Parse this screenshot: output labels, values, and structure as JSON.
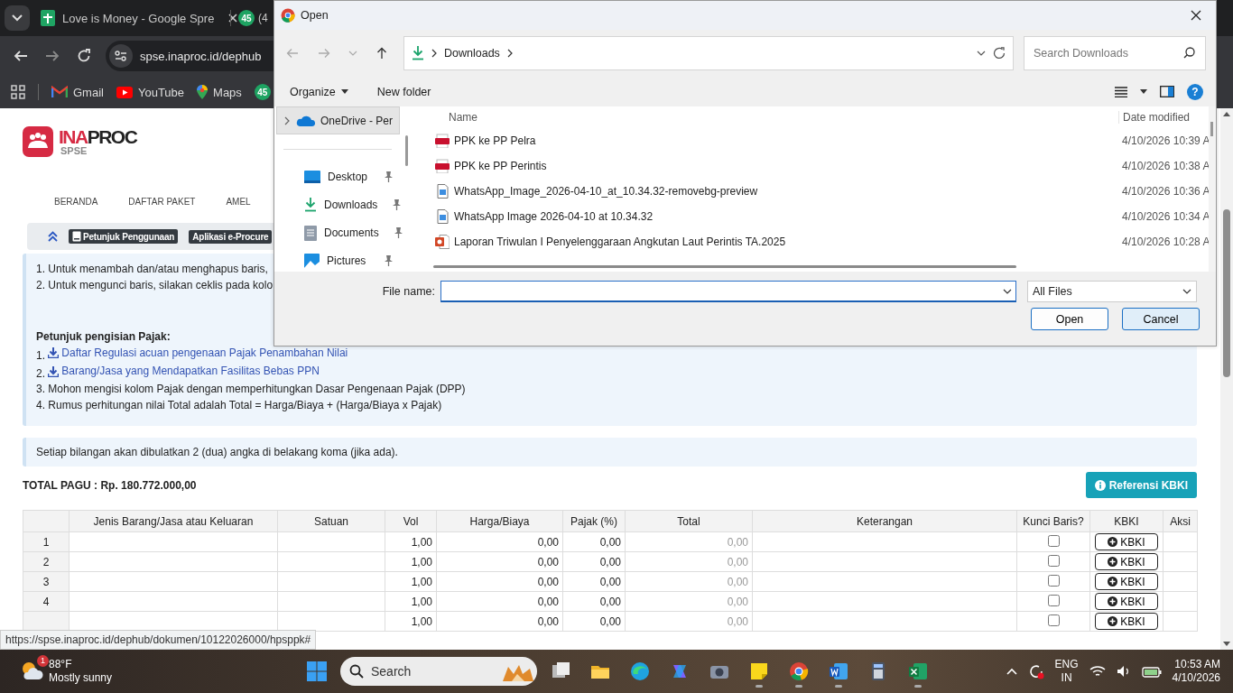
{
  "browser": {
    "tabs": [
      {
        "title": "Love is Money - Google Spre"
      },
      {
        "badge": "45",
        "title": "(4"
      }
    ],
    "address": "spse.inaproc.id/dephub",
    "bookmarks": [
      {
        "kind": "gmail",
        "label": "Gmail"
      },
      {
        "kind": "youtube",
        "label": "YouTube"
      },
      {
        "kind": "maps",
        "label": "Maps"
      },
      {
        "kind": "badge",
        "label": "45"
      }
    ]
  },
  "page": {
    "logo": {
      "prefix": "INA",
      "suffix": "PROC",
      "sub": "SPSE"
    },
    "nav": [
      "BERANDA",
      "DAFTAR PAKET",
      "AMEL"
    ],
    "help_bar": [
      "Petunjuk Penggunaan",
      "Aplikasi e-Procure"
    ],
    "instructions": [
      "1. Untuk menambah dan/atau menghapus baris,",
      "2. Untuk mengunci baris, silakan ceklis pada kolo"
    ],
    "tax_title": "Petunjuk pengisian Pajak:",
    "tax_items": [
      {
        "kind": "link",
        "number": "1.",
        "text": "Daftar Regulasi acuan pengenaan Pajak Penambahan Nilai"
      },
      {
        "kind": "link",
        "number": "2.",
        "text": "Barang/Jasa yang Mendapatkan Fasilitas Bebas PPN"
      },
      {
        "kind": "text",
        "text": "3. Mohon mengisi kolom Pajak dengan memperhitungkan Dasar Pengenaan Pajak (DPP)"
      },
      {
        "kind": "text",
        "text": "4. Rumus perhitungan nilai Total adalah Total = Harga/Biaya + (Harga/Biaya x Pajak)"
      }
    ],
    "note": "Setiap bilangan akan dibulatkan 2 (dua) angka di belakang koma (jika ada).",
    "total_pagu": "TOTAL PAGU : Rp. 180.772.000,00",
    "kbki_reference_button": "Referensi KBKI",
    "table": {
      "columns": [
        "",
        "Jenis Barang/Jasa atau Keluaran",
        "Satuan",
        "Vol",
        "Harga/Biaya",
        "Pajak (%)",
        "Total",
        "Keterangan",
        "Kunci Baris?",
        "KBKI",
        "Aksi"
      ],
      "rows": [
        {
          "no": "1",
          "vol": "1,00",
          "price": "0,00",
          "tax": "0,00",
          "total": "0,00",
          "locked": false,
          "kbki": "KBKI"
        },
        {
          "no": "2",
          "vol": "1,00",
          "price": "0,00",
          "tax": "0,00",
          "total": "0,00",
          "locked": false,
          "kbki": "KBKI"
        },
        {
          "no": "3",
          "vol": "1,00",
          "price": "0,00",
          "tax": "0,00",
          "total": "0,00",
          "locked": false,
          "kbki": "KBKI"
        },
        {
          "no": "4",
          "vol": "1,00",
          "price": "0,00",
          "tax": "0,00",
          "total": "0,00",
          "locked": false,
          "kbki": "KBKI"
        },
        {
          "vol": "1,00",
          "price": "0,00",
          "tax": "0,00",
          "total": "0,00",
          "locked": false,
          "kbki": "KBKI"
        }
      ]
    }
  },
  "status_url": "https://spse.inaproc.id/dephub/dokumen/10122026000/hpsppk#",
  "dialog": {
    "title": "Open",
    "path": [
      "Downloads"
    ],
    "search": {
      "placeholder": "Search Downloads"
    },
    "organize": "Organize",
    "new_folder": "New folder",
    "help": "?",
    "nav": [
      {
        "kind": "onedrive",
        "label": "OneDrive - Per",
        "selected": true,
        "pinned": false
      },
      {
        "kind": "desktop",
        "label": "Desktop",
        "selected": false,
        "pinned": true
      },
      {
        "kind": "downloads",
        "label": "Downloads",
        "selected": false,
        "pinned": true
      },
      {
        "kind": "documents",
        "label": "Documents",
        "selected": false,
        "pinned": true
      },
      {
        "kind": "pictures",
        "label": "Pictures",
        "selected": false,
        "pinned": true
      }
    ],
    "columns": [
      "Name",
      "Date modified"
    ],
    "files": [
      {
        "kind": "pdf",
        "name": "PPK ke PP Pelra",
        "date": "4/10/2026 10:39 A"
      },
      {
        "kind": "pdf",
        "name": "PPK ke PP Perintis",
        "date": "4/10/2026 10:38 A"
      },
      {
        "kind": "image",
        "name": "WhatsApp_Image_2026-04-10_at_10.34.32-removebg-preview",
        "date": "4/10/2026 10:36 A"
      },
      {
        "kind": "image",
        "name": "WhatsApp Image 2026-04-10 at 10.34.32",
        "date": "4/10/2026 10:34 A"
      },
      {
        "kind": "slides",
        "name": "Laporan Triwulan I Penyelenggaraan Angkutan Laut Perintis TA.2025",
        "date": "4/10/2026 10:28 A"
      }
    ],
    "file_name_label": "File name:",
    "filter": "All Files",
    "buttons": [
      {
        "label": "Open",
        "hovered": false
      },
      {
        "label": "Cancel",
        "hovered": true
      }
    ]
  },
  "taskbar": {
    "weather": {
      "badge": "1",
      "temp": "88°F",
      "desc": "Mostly sunny"
    },
    "search": "Search",
    "apps": [
      {
        "kind": "task-view",
        "running": false
      },
      {
        "kind": "folder",
        "running": false
      },
      {
        "kind": "edge",
        "running": false
      },
      {
        "kind": "copilot",
        "running": false
      },
      {
        "kind": "camera",
        "running": false
      },
      {
        "kind": "notes",
        "running": true
      },
      {
        "kind": "chrome",
        "running": true
      },
      {
        "kind": "word",
        "running": true
      },
      {
        "kind": "calculator",
        "running": false
      },
      {
        "kind": "excel",
        "running": true
      }
    ],
    "language": "ENG",
    "region": "IN",
    "time": "10:53 AM",
    "date": "4/10/2026"
  }
}
